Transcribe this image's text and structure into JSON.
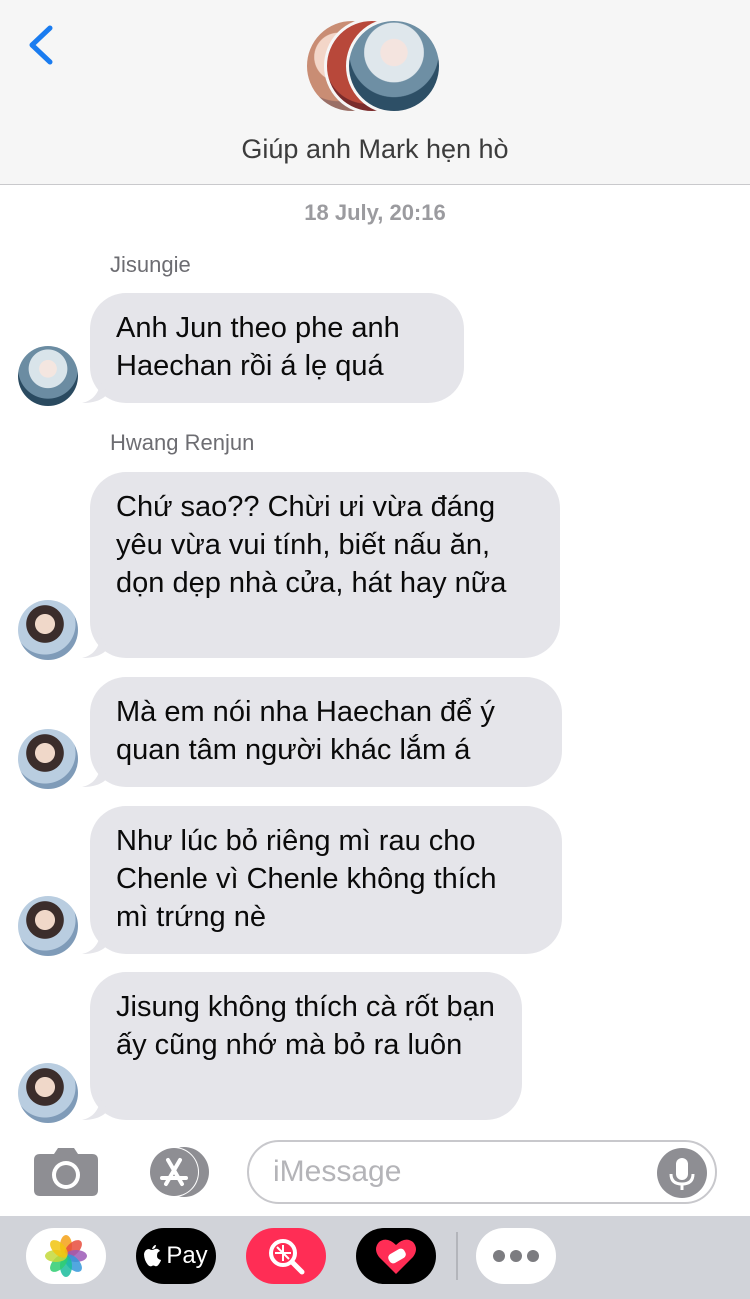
{
  "header": {
    "back_icon": "chevron-left-icon",
    "group_name": "Giúp anh Mark hẹn hò",
    "accent_color": "#1a7cf0"
  },
  "conversation": {
    "timestamp": "18 July, 20:16",
    "groups": [
      {
        "sender": "Jisungie",
        "messages": [
          "Anh Jun theo phe anh Haechan rồi á lẹ quá"
        ]
      },
      {
        "sender": "Hwang Renjun",
        "messages": [
          "Chứ sao?? Chừi ưi vừa đáng yêu vừa vui tính, biết nấu ăn, dọn dẹp nhà cửa, hát hay nữa",
          "Mà em nói nha Haechan để ý quan tâm người khác lắm á",
          "Như lúc bỏ riêng mì rau cho Chenle vì Chenle không thích mì trứng nè",
          "Jisung không thích cà rốt bạn ấy cũng nhớ mà bỏ ra luôn"
        ]
      }
    ],
    "bubble_color": "#e5e5ea"
  },
  "input": {
    "placeholder": "iMessage",
    "value": ""
  },
  "drawer": {
    "apps": [
      "photos-icon",
      "apple-pay-icon",
      "image-search-icon",
      "heart-stickers-icon",
      "more-icon"
    ],
    "pay_label": "Pay"
  }
}
